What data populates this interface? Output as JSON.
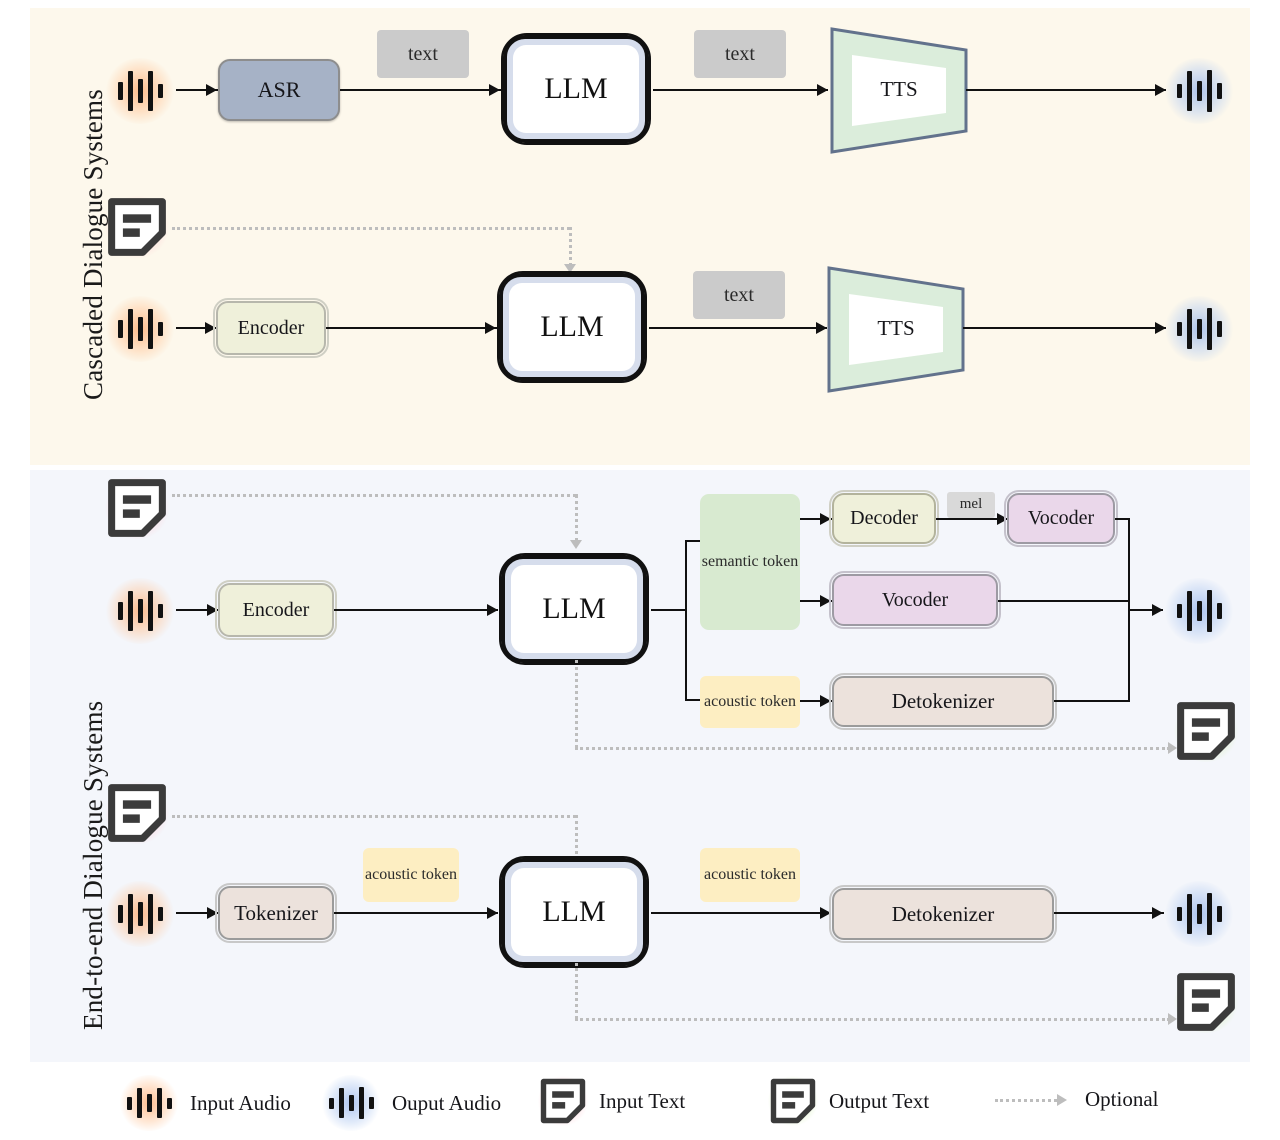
{
  "figure": {
    "type": "diagram",
    "sections": [
      {
        "id": "cascaded",
        "title": "Cascaded Dialogue Systems",
        "background": "#fdf8ec"
      },
      {
        "id": "end-to-end",
        "title": "End-to-end  Dialogue Systems",
        "background": "#f4f6fb"
      }
    ]
  },
  "cascaded": {
    "row1": {
      "input_audio": "input-audio-icon",
      "asr": "ASR",
      "chip_text_1": "text",
      "llm": "LLM",
      "chip_text_2": "text",
      "tts": "TTS",
      "output_audio": "output-audio-icon"
    },
    "row2": {
      "input_text": "input-text-icon",
      "input_audio": "input-audio-icon",
      "encoder": "Encoder",
      "llm": "LLM",
      "chip_text": "text",
      "tts": "TTS",
      "output_audio": "output-audio-icon"
    }
  },
  "end_to_end": {
    "row1": {
      "input_text": "input-text-icon",
      "input_audio": "input-audio-icon",
      "encoder": "Encoder",
      "llm": "LLM",
      "chip_semantic": "semantic token",
      "chip_acoustic": "acoustic token",
      "decoder": "Decoder",
      "chip_mel": "mel",
      "vocoder_top": "Vocoder",
      "vocoder_mid": "Vocoder",
      "detokenizer": "Detokenizer",
      "output_audio": "output-audio-icon",
      "output_text": "output-text-icon"
    },
    "row2": {
      "input_text": "input-text-icon",
      "input_audio": "input-audio-icon",
      "tokenizer": "Tokenizer",
      "chip_acoustic_in": "acoustic token",
      "llm": "LLM",
      "chip_acoustic_out": "acoustic token",
      "detokenizer": "Detokenizer",
      "output_audio": "output-audio-icon",
      "output_text": "output-text-icon"
    }
  },
  "legend": {
    "items": [
      {
        "icon": "input-audio-icon",
        "label": "Input Audio"
      },
      {
        "icon": "output-audio-icon",
        "label": "Ouput Audio"
      },
      {
        "icon": "input-text-icon",
        "label": "Input Text"
      },
      {
        "icon": "output-text-icon",
        "label": "Output Text"
      },
      {
        "icon": "dotted-arrow-icon",
        "label": "Optional"
      }
    ]
  },
  "colors": {
    "band_cascaded": "#fdf8ec",
    "band_end_to_end": "#f4f6fb",
    "asr_fill": "#a6b2c6",
    "encoder_fill": "#eff0da",
    "decoder_fill": "#eff0da",
    "vocoder_fill": "#ead7ea",
    "tokenizer_fill": "#ece2dc",
    "llm_fill": "#d6ddec",
    "chip_text_fill": "#cbcbcb",
    "chip_semantic_fill": "#d8ead0",
    "chip_acoustic_fill": "#fdeec2",
    "tts_fill": "#dbeddb",
    "wire": "#111111",
    "optional_wire": "#bdbdbd"
  }
}
